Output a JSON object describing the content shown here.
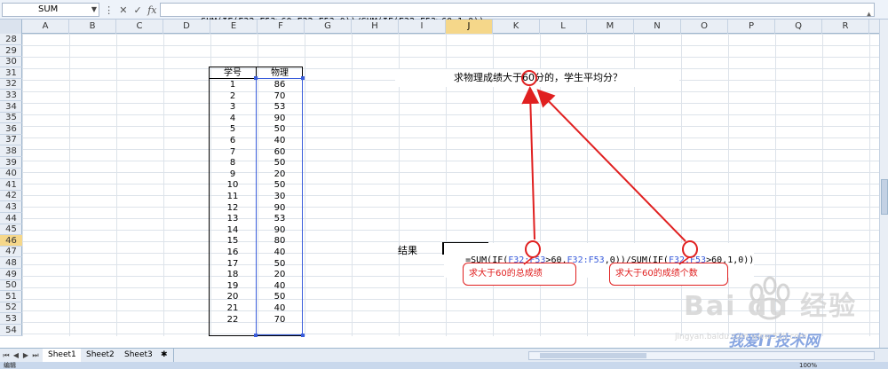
{
  "formula_bar": {
    "name_box": "SUM",
    "cancel_icon": "✕",
    "enter_icon": "✓",
    "fx_label": "fx",
    "formula": "=SUM(IF(F32:F53>60,F32:F53,0))/SUM(IF(F32:F53>60,1,0))"
  },
  "columns": [
    "A",
    "B",
    "C",
    "D",
    "E",
    "F",
    "G",
    "H",
    "I",
    "J",
    "K",
    "L",
    "M",
    "N",
    "O",
    "P",
    "Q",
    "R"
  ],
  "selected_column": "J",
  "rows": [
    "28",
    "29",
    "30",
    "31",
    "32",
    "33",
    "34",
    "35",
    "36",
    "37",
    "38",
    "39",
    "40",
    "41",
    "42",
    "43",
    "44",
    "45",
    "46",
    "47",
    "48",
    "49",
    "50",
    "51",
    "52",
    "53",
    "54"
  ],
  "selected_row": "46",
  "table": {
    "header_id": "学号",
    "header_score": "物理",
    "ids": [
      "1",
      "2",
      "3",
      "4",
      "5",
      "6",
      "7",
      "8",
      "9",
      "10",
      "11",
      "12",
      "13",
      "14",
      "15",
      "16",
      "17",
      "18",
      "19",
      "20",
      "21",
      "22"
    ],
    "scores": [
      "86",
      "70",
      "53",
      "90",
      "50",
      "40",
      "60",
      "50",
      "20",
      "50",
      "30",
      "90",
      "53",
      "90",
      "80",
      "40",
      "50",
      "20",
      "40",
      "50",
      "40",
      "70"
    ]
  },
  "question": "求物理成绩大于60分的，学生平均分？",
  "question_highlight": "60",
  "result_label": "结果",
  "edit_formula": {
    "p1": "=SUM(IF(",
    "r1": "F32:F53",
    "p2": ">",
    "n1": "60",
    "p3": ",",
    "r2": "F32:F53",
    "p4": ",0))/SUM(IF(",
    "r3": "F32:F53",
    "p5": ">",
    "n2": "60",
    "p6": ",1,0))"
  },
  "callouts": {
    "left": "求大于60的总成绩",
    "right": "求大于60的成绩个数"
  },
  "sheet_tabs": [
    "Sheet1",
    "Sheet2",
    "Sheet3"
  ],
  "status": {
    "mode": "编辑",
    "zoom": "100%"
  },
  "watermark": {
    "brand": "Bai du 经验",
    "site_cn": "我爱IT技术网",
    "site_url": "jingyan.baidu.com  www.52ij.com"
  },
  "colors": {
    "annotation": "#e02020",
    "selection": "#3a5ddb",
    "header_highlight": "#f5d78a"
  }
}
